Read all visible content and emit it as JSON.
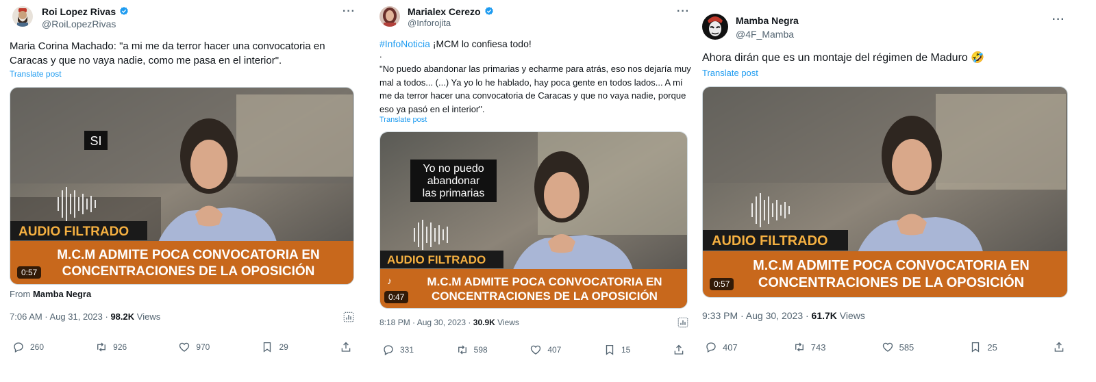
{
  "tweets": [
    {
      "name": "Roi Lopez Rivas",
      "handle": "@RoiLopezRivas",
      "text": "Maria Corina Machado: \"a mi me da terror hacer una convocatoria en Caracas y que no vaya nadie, como me pasa en el interior\".",
      "translate": "Translate post",
      "video": {
        "caption_top": "SI",
        "audio_label": "AUDIO FILTRADO",
        "banner_line1": "M.C.M ADMITE POCA CONVOCATORIA EN",
        "banner_line2": "CONCENTRACIONES DE LA OPOSICIÓN",
        "duration": "0:57"
      },
      "from_label": "From",
      "from_name": "Mamba Negra",
      "time": "7:06 AM · Aug 31, 2023 ·",
      "views_count": "98.2K",
      "views_label": "Views",
      "replies": "260",
      "reposts": "926",
      "likes": "970",
      "bookmarks": "29"
    },
    {
      "name": "Marialex Cerezo",
      "handle": "@Inforojita",
      "hashtag": "#InfoNoticia",
      "headline": "¡MCM lo confiesa todo!",
      "dot": ".",
      "quote": "\"No puedo abandonar las primarias y echarme para atrás, eso nos dejaría muy mal a todos... (...) Ya yo lo he hablado, hay poca gente en todos lados... A mí me da terror hacer una convocatoria de Caracas y que no vaya nadie, porque eso ya pasó en el interior\".",
      "translate": "Translate post",
      "video": {
        "caption_line1": "Yo no puedo",
        "caption_line2": "abandonar",
        "caption_line3": "las primarias",
        "audio_label": "AUDIO FILTRADO",
        "banner_line1": "M.C.M ADMITE POCA CONVOCATORIA EN",
        "banner_line2": "CONCENTRACIONES DE LA OPOSICIÓN",
        "duration": "0:47"
      },
      "time": "8:18 PM · Aug 30, 2023 ·",
      "views_count": "30.9K",
      "views_label": "Views",
      "replies": "331",
      "reposts": "598",
      "likes": "407",
      "bookmarks": "15"
    },
    {
      "name": "Mamba Negra",
      "handle": "@4F_Mamba",
      "text": "Ahora dirán que es un montaje del régimen de Maduro 🤣",
      "translate": "Translate post",
      "video": {
        "audio_label": "AUDIO FILTRADO",
        "banner_line1": "M.C.M ADMITE POCA CONVOCATORIA EN",
        "banner_line2": "CONCENTRACIONES DE LA OPOSICIÓN",
        "duration": "0:57"
      },
      "time": "9:33 PM · Aug 30, 2023 ·",
      "views_count": "61.7K",
      "views_label": "Views",
      "replies": "407",
      "reposts": "743",
      "likes": "585",
      "bookmarks": "25"
    }
  ],
  "colors": {
    "link": "#1d9bf0",
    "secondary": "#536471",
    "banner_orange": "#c8681c",
    "verified": "#1d9bf0"
  },
  "icons": [
    "reply-icon",
    "repost-icon",
    "like-icon",
    "bookmark-icon",
    "share-icon",
    "analytics-icon",
    "verified-badge-icon",
    "more-icon"
  ]
}
